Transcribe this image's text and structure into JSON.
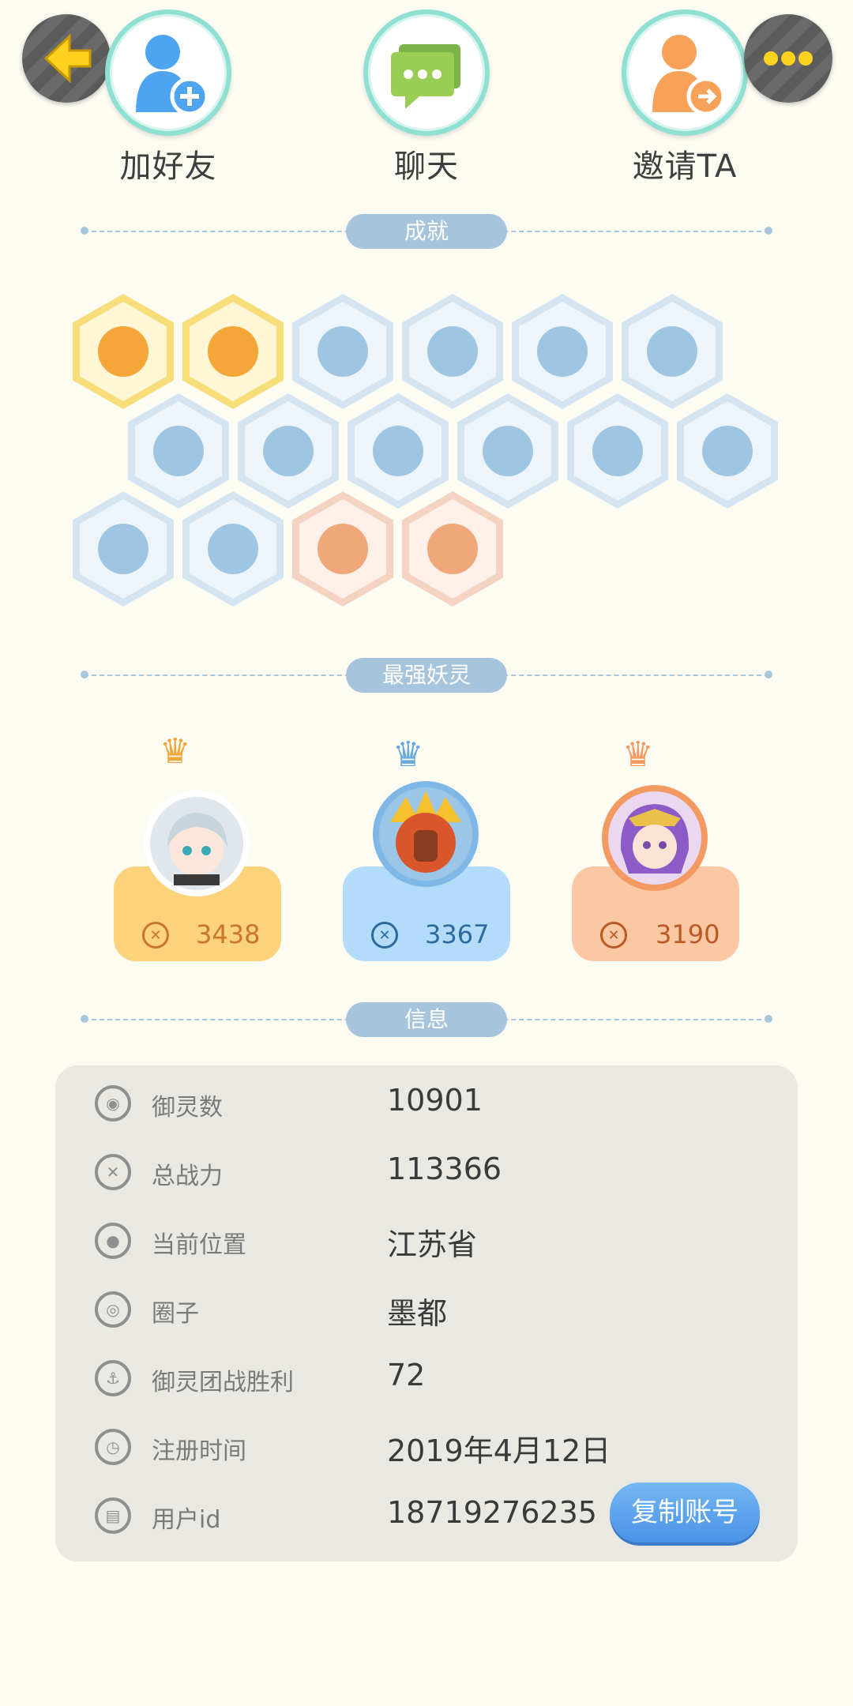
{
  "actions": {
    "add_friend": "加好友",
    "chat": "聊天",
    "invite": "邀请TA"
  },
  "sections": {
    "achievements": "成就",
    "strongest_spirits": "最强妖灵",
    "info": "信息"
  },
  "achievement_badges": [
    {
      "tier": "gold",
      "icon": "fox-face-icon"
    },
    {
      "tier": "gold",
      "icon": "golden-pot-icon"
    },
    {
      "tier": "blue",
      "icon": "shoe-icon"
    },
    {
      "tier": "blue",
      "icon": "orb-stand-icon"
    },
    {
      "tier": "blue",
      "icon": "moon-icon"
    },
    {
      "tier": "blue",
      "icon": "crystal-icon"
    },
    {
      "tier": "blue",
      "icon": "yin-yang-swirl-icon"
    },
    {
      "tier": "blue",
      "icon": "spirit-statue-icon"
    },
    {
      "tier": "blue",
      "icon": "cat-spirit-icon"
    },
    {
      "tier": "blue",
      "icon": "yin-yang-tablet-icon"
    },
    {
      "tier": "blue",
      "icon": "fish-spirit-icon"
    },
    {
      "tier": "blue",
      "icon": "banner-icon"
    },
    {
      "tier": "blue",
      "icon": "beast-icon"
    },
    {
      "tier": "blue",
      "icon": "book-icon"
    },
    {
      "tier": "peach",
      "icon": "cart-icon"
    },
    {
      "tier": "peach",
      "icon": "dragon-icon"
    }
  ],
  "spirits": [
    {
      "score": "3438",
      "theme": "#fcd27a",
      "text_color": "#c7762a",
      "ring": "#f3b54c"
    },
    {
      "score": "3367",
      "theme": "#b2dcf9",
      "text_color": "#2d6a9e",
      "ring": "#7fb8e6"
    },
    {
      "score": "3190",
      "theme": "#fcc8a4",
      "text_color": "#b95a24",
      "ring": "#f39a63"
    }
  ],
  "info": [
    {
      "label": "御灵数",
      "value": "10901",
      "icon": "spirit-count-icon"
    },
    {
      "label": "总战力",
      "value": "113366",
      "icon": "sword-icon"
    },
    {
      "label": "当前位置",
      "value": "江苏省",
      "icon": "location-pin-icon"
    },
    {
      "label": "圈子",
      "value": "墨都",
      "icon": "circle-target-icon"
    },
    {
      "label": "御灵团战胜利",
      "value": "72",
      "icon": "trophy-icon"
    },
    {
      "label": "注册时间",
      "value": "2019年4月12日",
      "icon": "clock-icon"
    },
    {
      "label": "用户id",
      "value": "18719276235",
      "icon": "id-card-icon"
    }
  ],
  "copy_button": "复制账号",
  "colors": {
    "background": "#fdfcf3",
    "accent_blue": "#4a92e6",
    "divider": "#a6c5dc"
  }
}
